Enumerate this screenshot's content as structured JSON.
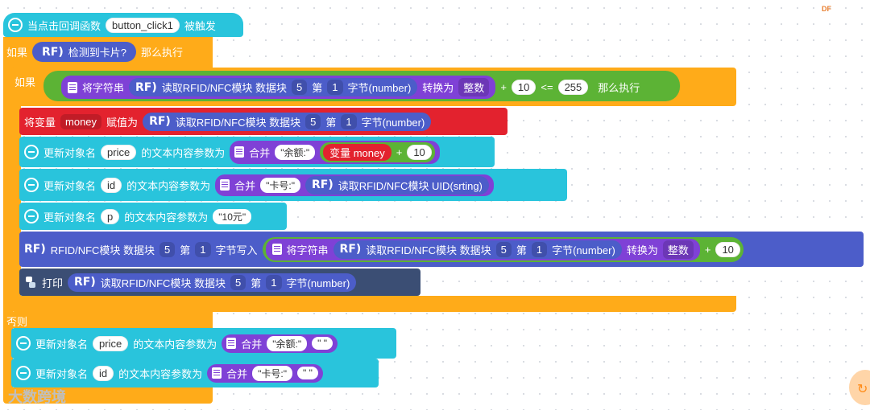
{
  "brand": {
    "corner": "DF",
    "watermark": "大数跨境"
  },
  "event": {
    "prefix": "当点击回调函数",
    "name": "button_click1",
    "suffix": "被触发"
  },
  "outer_if": {
    "if": "如果",
    "rf": "RF)",
    "cond": "检测到卡片?",
    "then": "那么执行",
    "else": "否则"
  },
  "inner_if": {
    "if": "如果",
    "to_str": "将字符串",
    "rf": "RF)",
    "read": "读取RFID/NFC模块 数据块",
    "block": "5",
    "nth": "第",
    "idx": "1",
    "byte": "字节(number)",
    "convert": "转换为",
    "type": "整数",
    "plus": "+",
    "add": "10",
    "lte": "<=",
    "limit": "255",
    "then": "那么执行"
  },
  "assign": {
    "label": "将变量",
    "var": "money",
    "assign": "赋值为",
    "rf": "RF)",
    "read": "读取RFID/NFC模块 数据块",
    "block": "5",
    "nth": "第",
    "idx": "1",
    "byte": "字节(number)"
  },
  "update_price": {
    "label": "更新对象名",
    "obj": "price",
    "mid": "的文本内容参数为",
    "merge": "合并",
    "str": "\"余额:\"",
    "var": "变量 money",
    "plus": "+",
    "add": "10"
  },
  "update_id": {
    "label": "更新对象名",
    "obj": "id",
    "mid": "的文本内容参数为",
    "merge": "合并",
    "str": "\"卡号:\"",
    "rf": "RF)",
    "read_uid": "读取RFID/NFC模块 UID(srting)"
  },
  "update_p": {
    "label": "更新对象名",
    "obj": "p",
    "mid": "的文本内容参数为",
    "str": "\"10元\""
  },
  "write": {
    "rf": "RF)",
    "label": "RFID/NFC模块 数据块",
    "block": "5",
    "nth": "第",
    "idx": "1",
    "write": "字节写入",
    "to_str": "将字符串",
    "rf2": "RF)",
    "read": "读取RFID/NFC模块 数据块",
    "block2": "5",
    "nth2": "第",
    "idx2": "1",
    "byte": "字节(number)",
    "convert": "转换为",
    "type": "整数",
    "plus": "+",
    "add": "10"
  },
  "print": {
    "label": "打印",
    "rf": "RF)",
    "read": "读取RFID/NFC模块 数据块",
    "block": "5",
    "nth": "第",
    "idx": "1",
    "byte": "字节(number)"
  },
  "else_price": {
    "label": "更新对象名",
    "obj": "price",
    "mid": "的文本内容参数为",
    "merge": "合并",
    "str1": "\"余额:\"",
    "str2": "\" \""
  },
  "else_id": {
    "label": "更新对象名",
    "obj": "id",
    "mid": "的文本内容参数为",
    "merge": "合并",
    "str1": "\"卡号:\"",
    "str2": "\" \""
  }
}
